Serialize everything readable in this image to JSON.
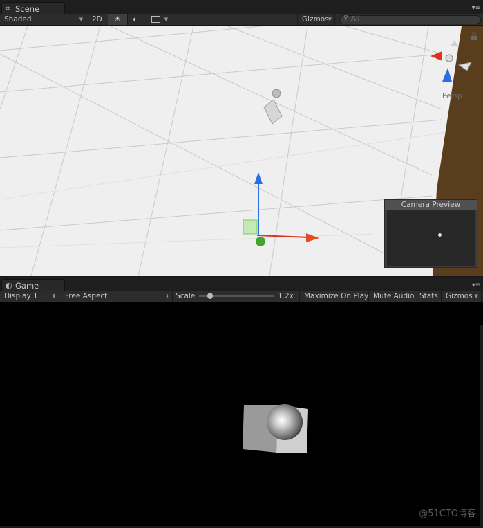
{
  "scene": {
    "tab_label": "Scene",
    "toolbar": {
      "shading_mode": "Shaded",
      "mode_2d": "2D",
      "gizmos": "Gizmos",
      "search_placeholder": "All"
    },
    "viewport": {
      "persp_label": "Persp",
      "background_color": "#efefef",
      "camera_preview_title": "Camera Preview"
    }
  },
  "game": {
    "tab_label": "Game",
    "toolbar": {
      "display": "Display 1",
      "aspect": "Free Aspect",
      "scale_label": "Scale",
      "scale_value": "1.2x",
      "scale_fraction": 0.15,
      "maximize": "Maximize On Play",
      "mute": "Mute Audio",
      "stats": "Stats",
      "gizmos": "Gizmos"
    }
  },
  "watermark": "@51CTO博客",
  "icons": [
    "scene-grid-icon",
    "sun-icon",
    "audio-icon",
    "image-icon",
    "search-icon",
    "game-icon",
    "lock-icon",
    "menu-icon"
  ]
}
